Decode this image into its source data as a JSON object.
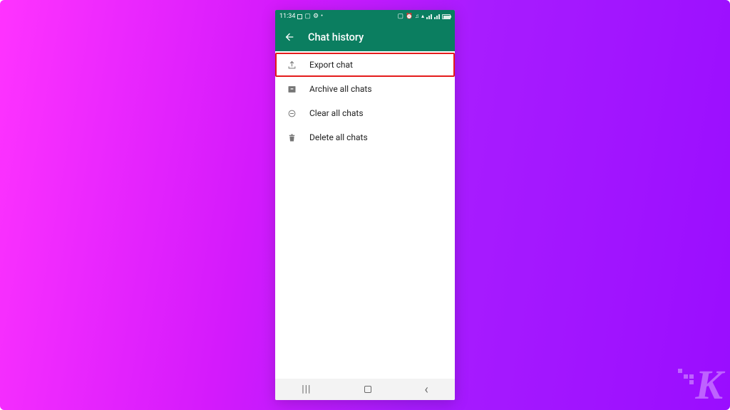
{
  "statusbar": {
    "time": "11:34"
  },
  "appbar": {
    "title": "Chat history"
  },
  "menu": {
    "items": [
      {
        "key": "export",
        "label": "Export chat",
        "icon": "upload-icon",
        "highlight": true
      },
      {
        "key": "archive",
        "label": "Archive all chats",
        "icon": "archive-icon",
        "highlight": false
      },
      {
        "key": "clear",
        "label": "Clear all chats",
        "icon": "clear-icon",
        "highlight": false
      },
      {
        "key": "delete",
        "label": "Delete all chats",
        "icon": "trash-icon",
        "highlight": false
      }
    ]
  },
  "colors": {
    "brand": "#0b7e60",
    "highlight": "#e41b1b"
  },
  "watermark": {
    "letter": "K"
  }
}
